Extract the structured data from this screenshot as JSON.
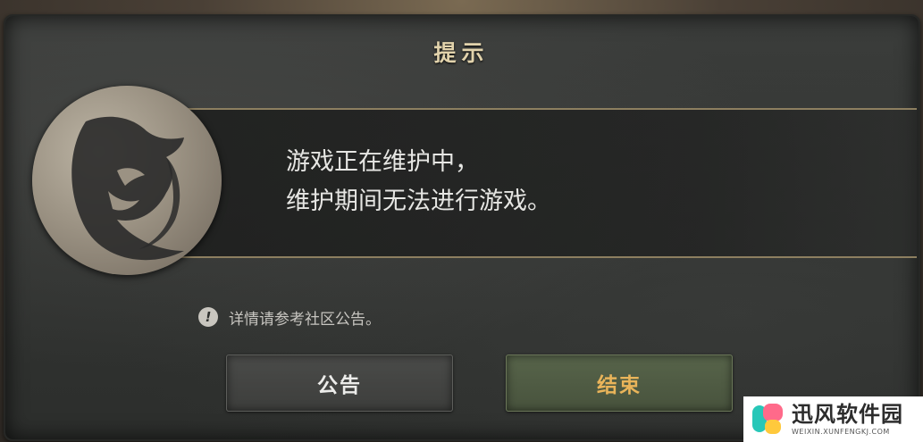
{
  "dialog": {
    "title": "提示",
    "message_line1": "游戏正在维护中，",
    "message_line2": "维护期间无法进行游戏。",
    "notice_icon": "!",
    "notice_text": "详情请参考社区公告。",
    "buttons": {
      "notice_label": "公告",
      "end_label": "结束"
    },
    "emblem_icon": "lion-head-emblem-icon"
  },
  "watermark": {
    "title": "迅风软件园",
    "subtitle": "WEIXIN.XUNFENGKJ.COM"
  },
  "colors": {
    "title": "#e2d3ac",
    "end_button_text": "#e9b45a",
    "end_button_bg": "#57644a",
    "notice_button_bg": "#4a4b49"
  }
}
